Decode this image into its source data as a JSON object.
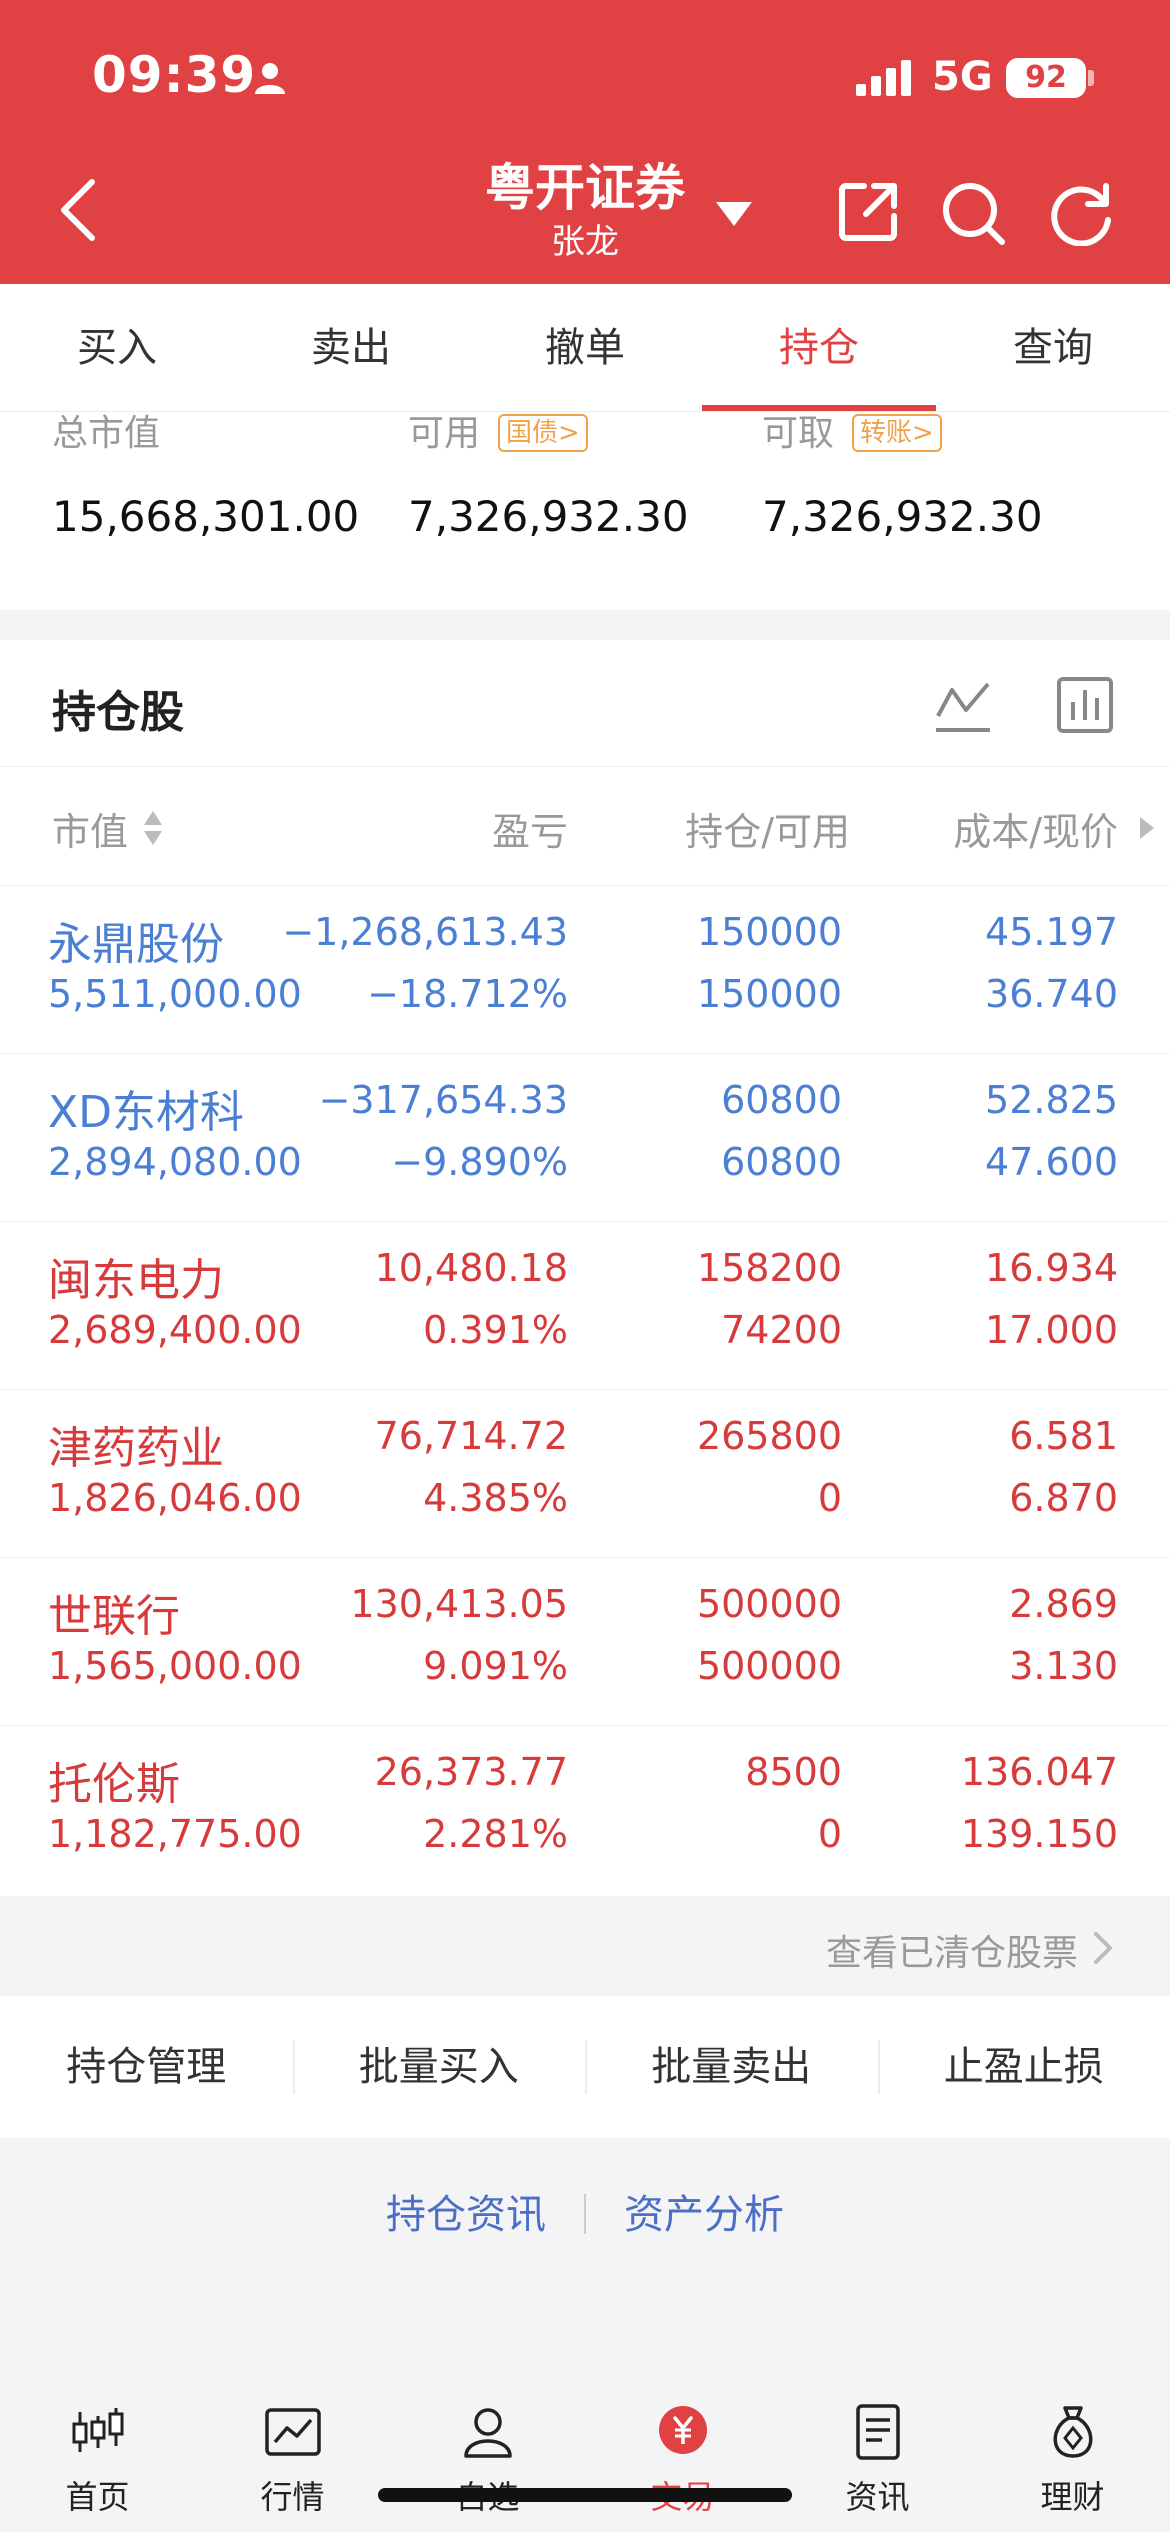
{
  "status": {
    "time": "09:39",
    "network": "5G",
    "battery": "92"
  },
  "header": {
    "title": "粤开证券",
    "subtitle": "张龙"
  },
  "tabs": [
    {
      "label": "买入",
      "active": false
    },
    {
      "label": "卖出",
      "active": false
    },
    {
      "label": "撤单",
      "active": false
    },
    {
      "label": "持仓",
      "active": true
    },
    {
      "label": "查询",
      "active": false
    }
  ],
  "summary": {
    "total_label": "总市值",
    "total_value": "15,668,301.00",
    "available_label": "可用",
    "available_tag": "国债>",
    "available_value": "7,326,932.30",
    "withdrawable_label": "可取",
    "withdrawable_tag": "转账>",
    "withdrawable_value": "7,326,932.30"
  },
  "holdings": {
    "title": "持仓股",
    "columns": {
      "market_value": "市值",
      "pl": "盈亏",
      "position": "持仓/可用",
      "cost": "成本/现价"
    },
    "rows": [
      {
        "name": "永鼎股份",
        "market_value": "5,511,000.00",
        "pl": "−1,268,613.43",
        "pl_pct": "−18.712%",
        "position": "150000",
        "available": "150000",
        "cost": "45.197",
        "price": "36.740",
        "trend": "loss"
      },
      {
        "name": "XD东材科",
        "market_value": "2,894,080.00",
        "pl": "−317,654.33",
        "pl_pct": "−9.890%",
        "position": "60800",
        "available": "60800",
        "cost": "52.825",
        "price": "47.600",
        "trend": "loss"
      },
      {
        "name": "闽东电力",
        "market_value": "2,689,400.00",
        "pl": "10,480.18",
        "pl_pct": "0.391%",
        "position": "158200",
        "available": "74200",
        "cost": "16.934",
        "price": "17.000",
        "trend": "gain"
      },
      {
        "name": "津药药业",
        "market_value": "1,826,046.00",
        "pl": "76,714.72",
        "pl_pct": "4.385%",
        "position": "265800",
        "available": "0",
        "cost": "6.581",
        "price": "6.870",
        "trend": "gain"
      },
      {
        "name": "世联行",
        "market_value": "1,565,000.00",
        "pl": "130,413.05",
        "pl_pct": "9.091%",
        "position": "500000",
        "available": "500000",
        "cost": "2.869",
        "price": "3.130",
        "trend": "gain"
      },
      {
        "name": "托伦斯",
        "market_value": "1,182,775.00",
        "pl": "26,373.77",
        "pl_pct": "2.281%",
        "position": "8500",
        "available": "0",
        "cost": "136.047",
        "price": "139.150",
        "trend": "gain"
      }
    ],
    "view_cleared": "查看已清仓股票"
  },
  "actions": [
    "持仓管理",
    "批量买入",
    "批量卖出",
    "止盈止损"
  ],
  "links": [
    "持仓资讯",
    "资产分析"
  ],
  "bottom_nav": [
    {
      "label": "首页",
      "icon": "candlestick-icon",
      "active": false
    },
    {
      "label": "行情",
      "icon": "chart-icon",
      "active": false
    },
    {
      "label": "自选",
      "icon": "user-icon",
      "active": false
    },
    {
      "label": "交易",
      "icon": "yuan-icon",
      "active": true
    },
    {
      "label": "资讯",
      "icon": "document-icon",
      "active": false
    },
    {
      "label": "理财",
      "icon": "money-bag-icon",
      "active": false
    }
  ],
  "colors": {
    "brand": "#e04142",
    "loss": "#4a7fd4",
    "gain": "#d63a3a",
    "tag": "#f0a24a"
  }
}
